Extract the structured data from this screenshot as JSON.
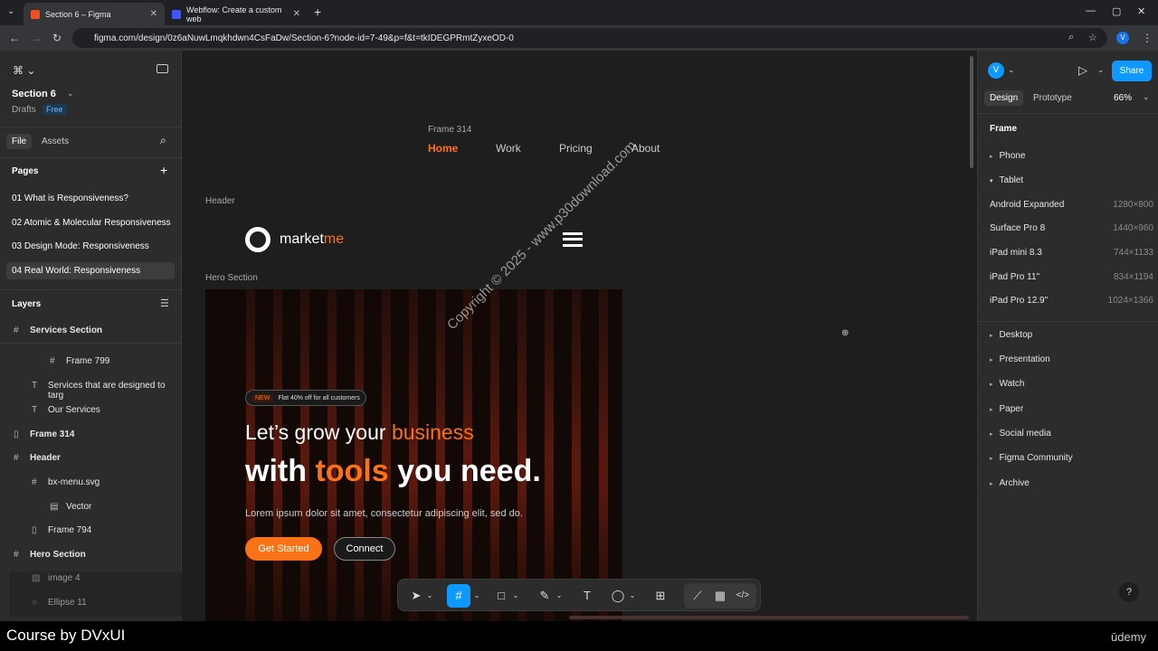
{
  "browser": {
    "tabs": [
      {
        "label": "Section 6 – Figma"
      },
      {
        "label": "Webflow: Create a custom web"
      }
    ],
    "url": "figma.com/design/0z6aNuwLmqkhdwn4CsFaDw/Section-6?node-id=7-49&p=f&t=tkIDEGPRmtZyxeOD-0",
    "profile": "V"
  },
  "left": {
    "file_name": "Section 6",
    "location": "Drafts",
    "plan": "Free",
    "tabs": [
      "File",
      "Assets"
    ],
    "pages_title": "Pages",
    "pages": [
      "01 What is Responsiveness?",
      "02 Atomic & Molecular Responsiveness",
      "03 Design Mode: Responsiveness",
      "04 Real World: Responsiveness"
    ],
    "layers_title": "Layers",
    "layers": [
      "Services Section",
      "Frame 799",
      "Services that are designed to targ",
      "Our Services",
      "Frame 314",
      "Header",
      "bx-menu.svg",
      "Vector",
      "Frame 794",
      "Hero Section",
      "image 4",
      "Ellipse 11"
    ]
  },
  "canvas": {
    "frame314_label": "Frame 314",
    "nav": [
      "Home",
      "Work",
      "Pricing",
      "About"
    ],
    "header_label": "Header",
    "logo_a": "market",
    "logo_b": "me",
    "hero_label": "Hero Section",
    "badge_new": "NEW",
    "badge_text": "Flat 40% off for all customers",
    "h1_a": "Let’s grow your ",
    "h1_b": "business",
    "h2_a": "with ",
    "h2_b": "tools",
    " h2_c": " you need.",
    "h2c": " you need.",
    "body": "Lorem ipsum dolor sit amet, consectetur adipiscing elit, sed do.",
    "btn_primary": "Get Started",
    "btn_secondary": "Connect",
    "watermark": "Copyright © 2025 - www.p30download.com"
  },
  "right": {
    "share": "Share",
    "tabs": [
      "Design",
      "Prototype"
    ],
    "zoom": "66%",
    "section": "Frame",
    "groups": [
      "Phone",
      "Tablet",
      "Desktop",
      "Presentation",
      "Watch",
      "Paper",
      "Social media",
      "Figma Community",
      "Archive"
    ],
    "tablet_items": [
      {
        "name": "Android Expanded",
        "size": "1280×800"
      },
      {
        "name": "Surface Pro 8",
        "size": "1440×960"
      },
      {
        "name": "iPad mini 8.3",
        "size": "744×1133"
      },
      {
        "name": "iPad Pro 11\"",
        "size": "834×1194"
      },
      {
        "name": "iPad Pro 12.9\"",
        "size": "1024×1366"
      }
    ],
    "help": "?"
  },
  "footer": {
    "course": "Course by DVxUI",
    "brand": "ūdemy"
  },
  "colors": {
    "accent": "#f97316",
    "figma_blue": "#0d99ff"
  }
}
